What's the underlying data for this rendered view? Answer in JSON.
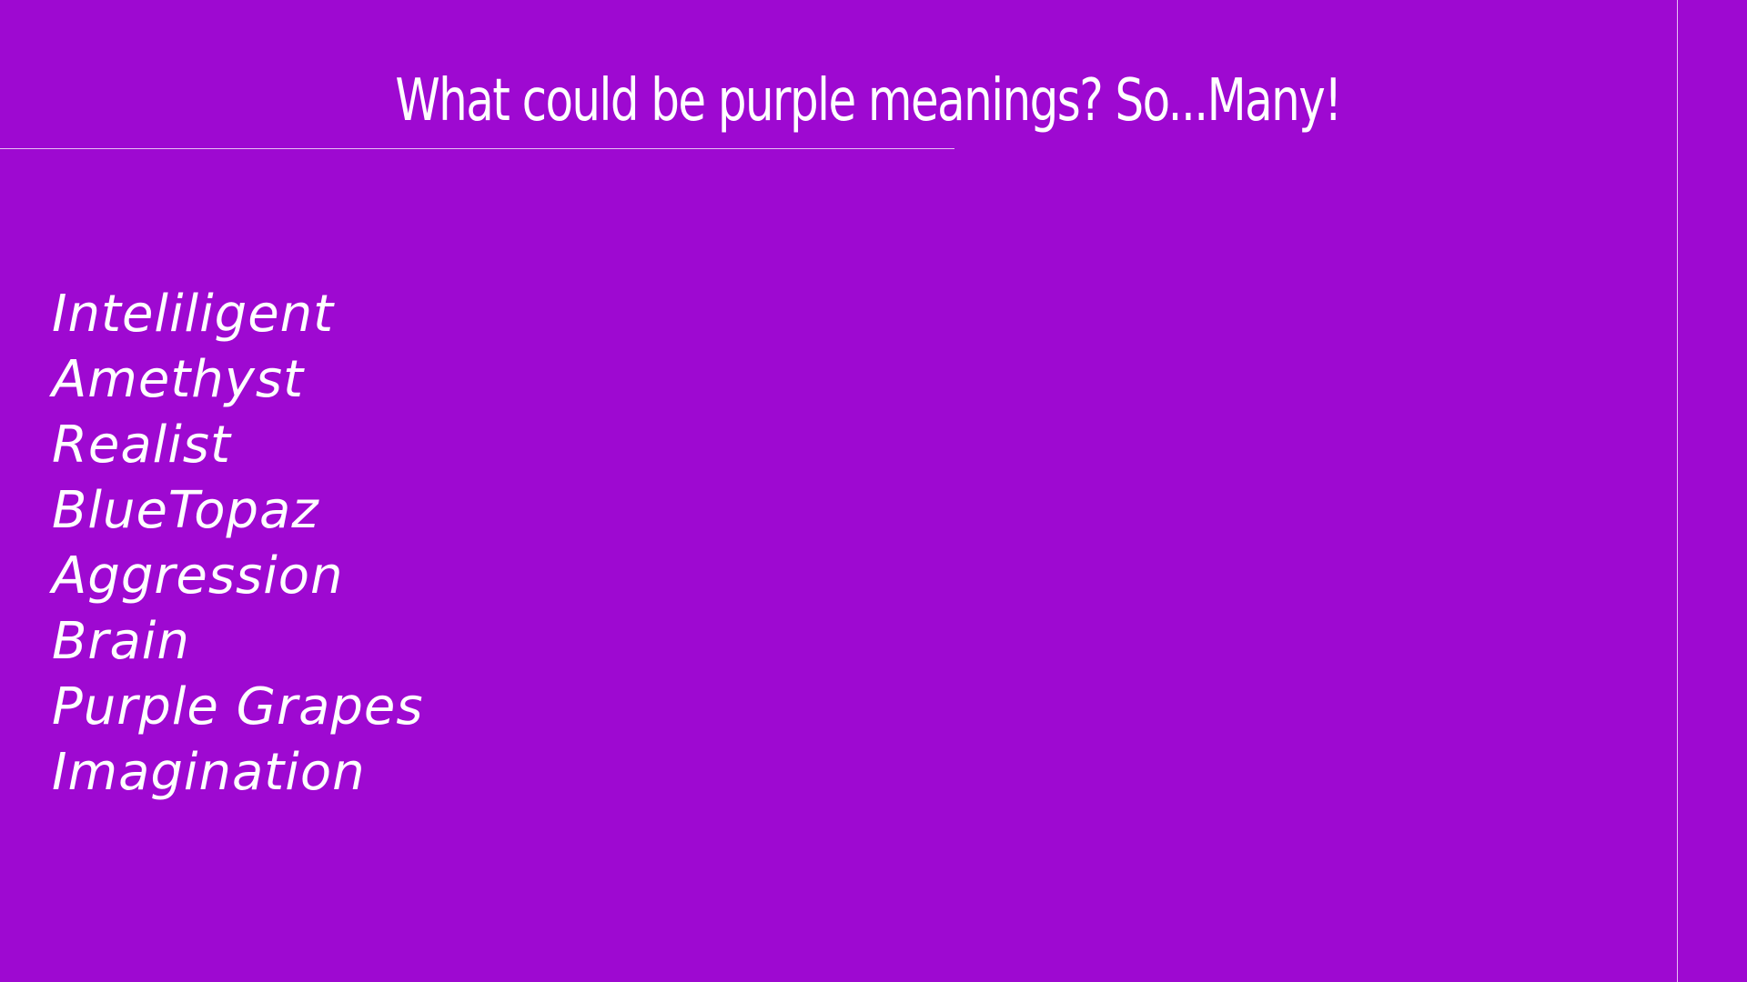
{
  "slide": {
    "title": "What could be purple meanings? So...Many!",
    "items": [
      "Inteliligent",
      "Amethyst",
      "Realist",
      "BlueTopaz",
      "Aggression",
      "Brain",
      "Purple  Grapes",
      "Imagination"
    ]
  },
  "colors": {
    "background": "#9e09d1",
    "text": "#ffffff",
    "rule": "#e8c2f4"
  }
}
